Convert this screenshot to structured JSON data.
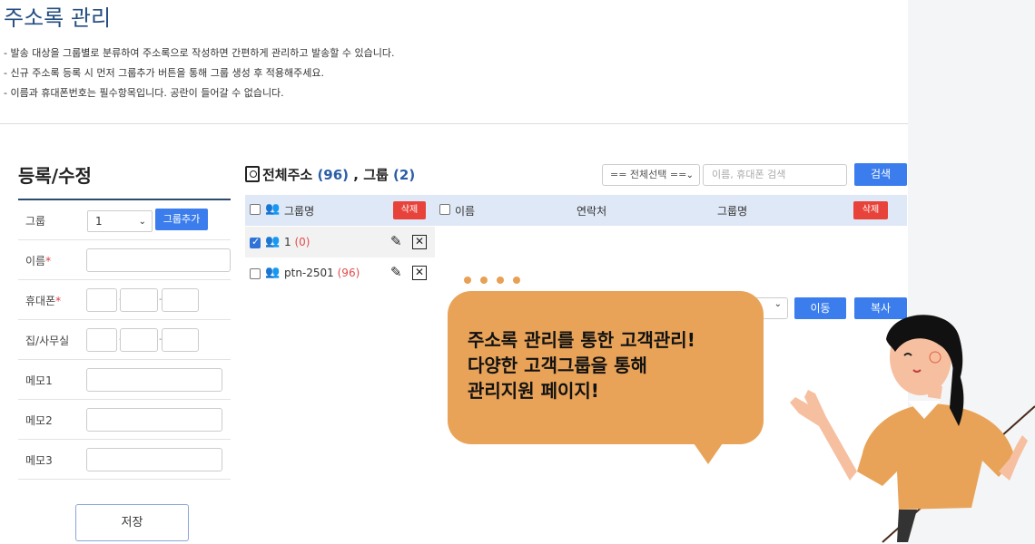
{
  "page": {
    "title": "주소록 관리",
    "descriptions": [
      "- 발송 대상을 그룹별로 분류하여 주소록으로 작성하면 간편하게 관리하고 발송할 수 있습니다.",
      "- 신규 주소록 등록 시 먼저 그룹추가 버튼을 통해 그룹 생성 후 적용해주세요.",
      "- 이름과 휴대폰번호는 필수항목입니다. 공란이 들어갈 수 없습니다."
    ]
  },
  "form": {
    "title": "등록/수정",
    "group_label": "그룹",
    "group_value": "1",
    "add_group_label": "그룹추가",
    "name_label": "이름",
    "phone_label": "휴대폰",
    "home_label": "집/사무실",
    "memo1_label": "메모1",
    "memo2_label": "메모2",
    "memo3_label": "메모3",
    "required_mark": "*",
    "dash": "-",
    "save_label": "저장"
  },
  "addressbook": {
    "title_prefix": "전체주소",
    "total_count": "(96)",
    "separator": ",",
    "group_word": "그룹",
    "group_count": "(2)",
    "search_select": "== 전체선택 ==",
    "search_placeholder": "이름, 휴대폰 검색",
    "search_label": "검색",
    "group_col_header": "그룹명",
    "delete_label": "삭제",
    "name_col": "이름",
    "contact_col": "연락처",
    "groupname_col": "그룹명",
    "groups": [
      {
        "name": "1",
        "count": "(0)",
        "checked": true
      },
      {
        "name": "ptn-2501",
        "count": "(96)",
        "checked": false
      }
    ],
    "move_label": "이동",
    "copy_label": "복사"
  },
  "promo": {
    "line1": "주소록 관리를 통한 고객관리!",
    "line2": "다양한 고객그룹을 통해",
    "line3": "관리지원 페이지!"
  },
  "colors": {
    "title_blue": "#244e82",
    "button_blue": "#3b7ded",
    "button_red": "#e8433a",
    "bubble": "#e8a358",
    "header_bg": "#dfe8f6"
  }
}
